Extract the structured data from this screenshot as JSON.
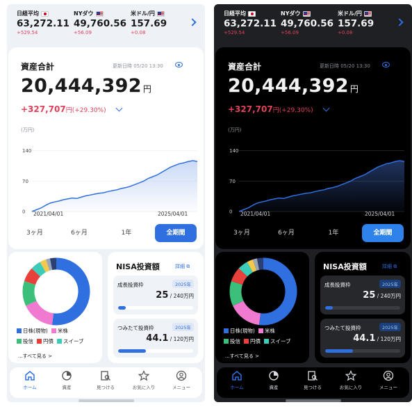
{
  "tickers": [
    {
      "name": "日経平均",
      "flag": "jp",
      "value": "63,272.11",
      "change": "+529.54"
    },
    {
      "name": "NYダウ",
      "flag": "us",
      "value": "49,760.56",
      "change": "+56.09"
    },
    {
      "name": "米ドル/円",
      "flag": "usjp",
      "value": "157.69",
      "change": "+0.08"
    }
  ],
  "asset": {
    "title": "資産合計",
    "updated": "更新日時 05/20 13:30",
    "total": "20,444,392",
    "total_unit": "円",
    "gain": "+327,707",
    "gain_unit": "円",
    "gain_pct": "(+29.30%)",
    "y_unit": "(万円)"
  },
  "chart_data": {
    "type": "area",
    "x_start": "2021/04/01",
    "x_end": "2025/04/01",
    "y_ticks": [
      0,
      70,
      140
    ],
    "ylim": [
      0,
      160
    ],
    "values": [
      0,
      4,
      8,
      14,
      19,
      22,
      24,
      27,
      29,
      31,
      30,
      33,
      36,
      38,
      40,
      42,
      43,
      46,
      48,
      50,
      53,
      55,
      58,
      62,
      66,
      70,
      76,
      80,
      84,
      90,
      96,
      102,
      106,
      110,
      112,
      115,
      117,
      115
    ],
    "title": "",
    "xlabel": "",
    "ylabel": "(万円)"
  },
  "periods": [
    {
      "label": "3ヶ月",
      "active": false
    },
    {
      "label": "6ヶ月",
      "active": false
    },
    {
      "label": "1年",
      "active": false
    },
    {
      "label": "全期間",
      "active": true
    }
  ],
  "allocation": {
    "legend": [
      {
        "label": "日株(現物)",
        "color": "#2f6fe0"
      },
      {
        "label": "米株",
        "color": "#f07ad0"
      },
      {
        "label": "投信",
        "color": "#3bbf7a"
      },
      {
        "label": "円債",
        "color": "#e8403a"
      },
      {
        "label": "スイーブ",
        "color": "#3ccdb9"
      }
    ],
    "see_all": "...すべて見る >",
    "slices": [
      {
        "value": 52,
        "color": "#2f6fe0"
      },
      {
        "value": 16,
        "color": "#f07ad0"
      },
      {
        "value": 12,
        "color": "#3bbf7a"
      },
      {
        "value": 7,
        "color": "#e8403a"
      },
      {
        "value": 5,
        "color": "#3ccdb9"
      },
      {
        "value": 3,
        "color": "#f2c94c"
      },
      {
        "value": 2,
        "color": "#9aa7b8"
      },
      {
        "value": 3,
        "color": "#2c3f73"
      }
    ]
  },
  "nisa": {
    "title": "NISA投資額",
    "detail": "詳細",
    "growth": {
      "label": "成長投資枠",
      "year": "2025年",
      "used": "25",
      "limit": "/ 240万円",
      "ratio": 0.104
    },
    "tsumitate": {
      "label": "つみたて投資枠",
      "year": "2025年",
      "used": "44.1",
      "limit": "/ 120万円",
      "ratio": 0.3675
    }
  },
  "nav": [
    {
      "label": "ホーム",
      "icon": "home-icon",
      "active": true
    },
    {
      "label": "資産",
      "icon": "pie-icon",
      "active": false
    },
    {
      "label": "見つける",
      "icon": "search-doc-icon",
      "active": false
    },
    {
      "label": "お気に入り",
      "icon": "star-icon",
      "active": false
    },
    {
      "label": "メニュー",
      "icon": "user-icon",
      "active": false
    }
  ],
  "colors": {
    "accent": "#2f6fe0",
    "positive": "#e0405a"
  }
}
